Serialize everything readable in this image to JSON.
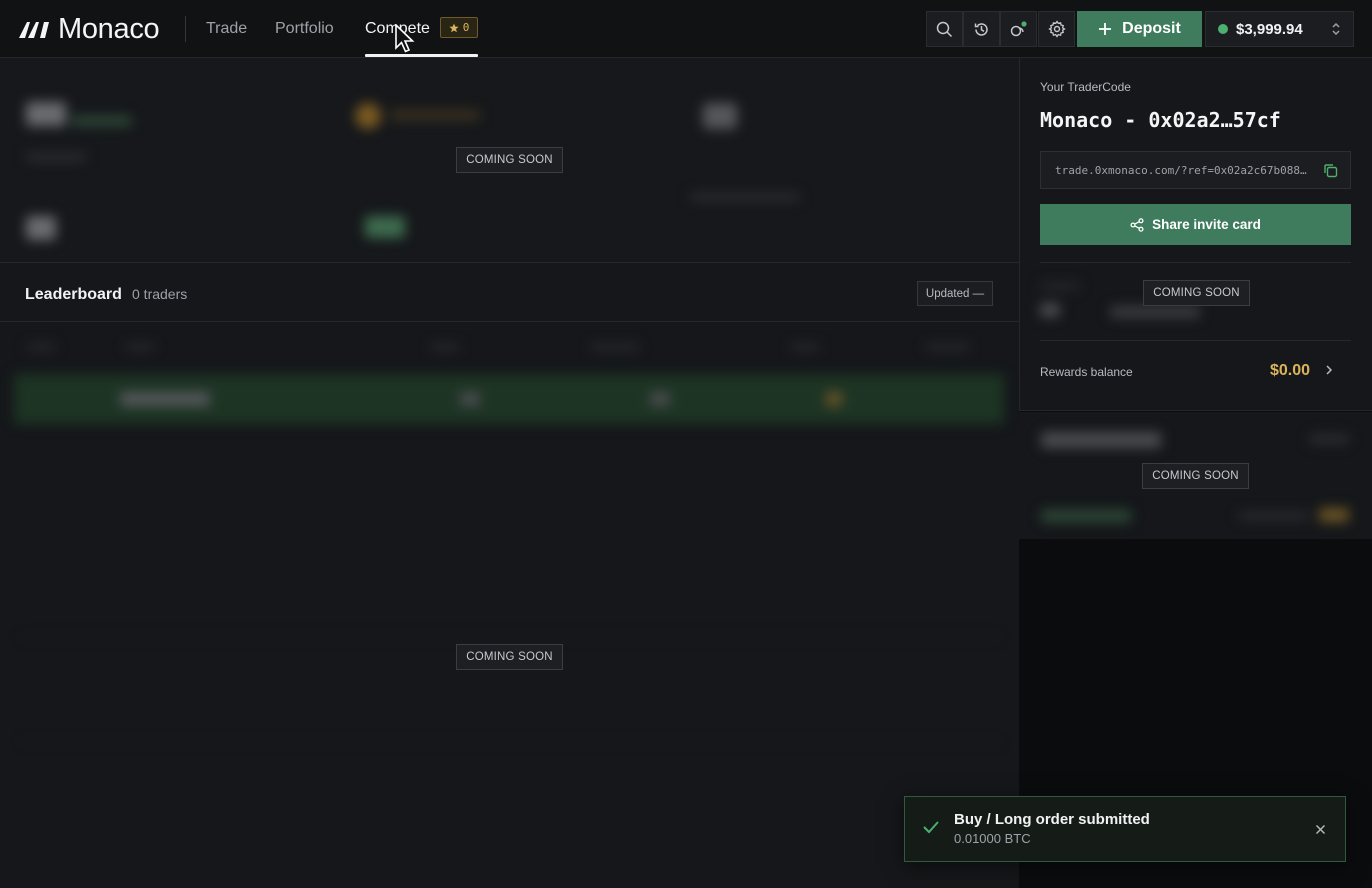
{
  "header": {
    "brand": "Monaco",
    "nav": [
      {
        "label": "Trade"
      },
      {
        "label": "Portfolio"
      },
      {
        "label": "Compete"
      }
    ],
    "compete_badge": "0",
    "deposit_label": "Deposit",
    "balance": "$3,999.94",
    "icons": [
      "search-icon",
      "history-icon",
      "activity-icon",
      "gear-icon"
    ]
  },
  "stats": {
    "coming_soon": "COMING SOON"
  },
  "leaderboard": {
    "title": "Leaderboard",
    "count": "0 traders",
    "updated": "Updated —",
    "coming_soon": "COMING SOON"
  },
  "tradercode": {
    "label": "Your TraderCode",
    "code": "Monaco - 0x02a2…57cf",
    "ref_link": "trade.0xmonaco.com/?ref=0x02a2c67b088…",
    "share_label": "Share invite card",
    "coming_soon": "COMING SOON",
    "rewards_label": "Rewards balance",
    "rewards_value": "$0.00"
  },
  "side_panel": {
    "coming_soon": "COMING SOON"
  },
  "toast": {
    "title": "Buy / Long order submitted",
    "subtitle": "0.01000 BTC"
  },
  "colors": {
    "accent_green": "#3f7b5d",
    "gold": "#d9b45a",
    "status_green": "#4caf6e"
  }
}
